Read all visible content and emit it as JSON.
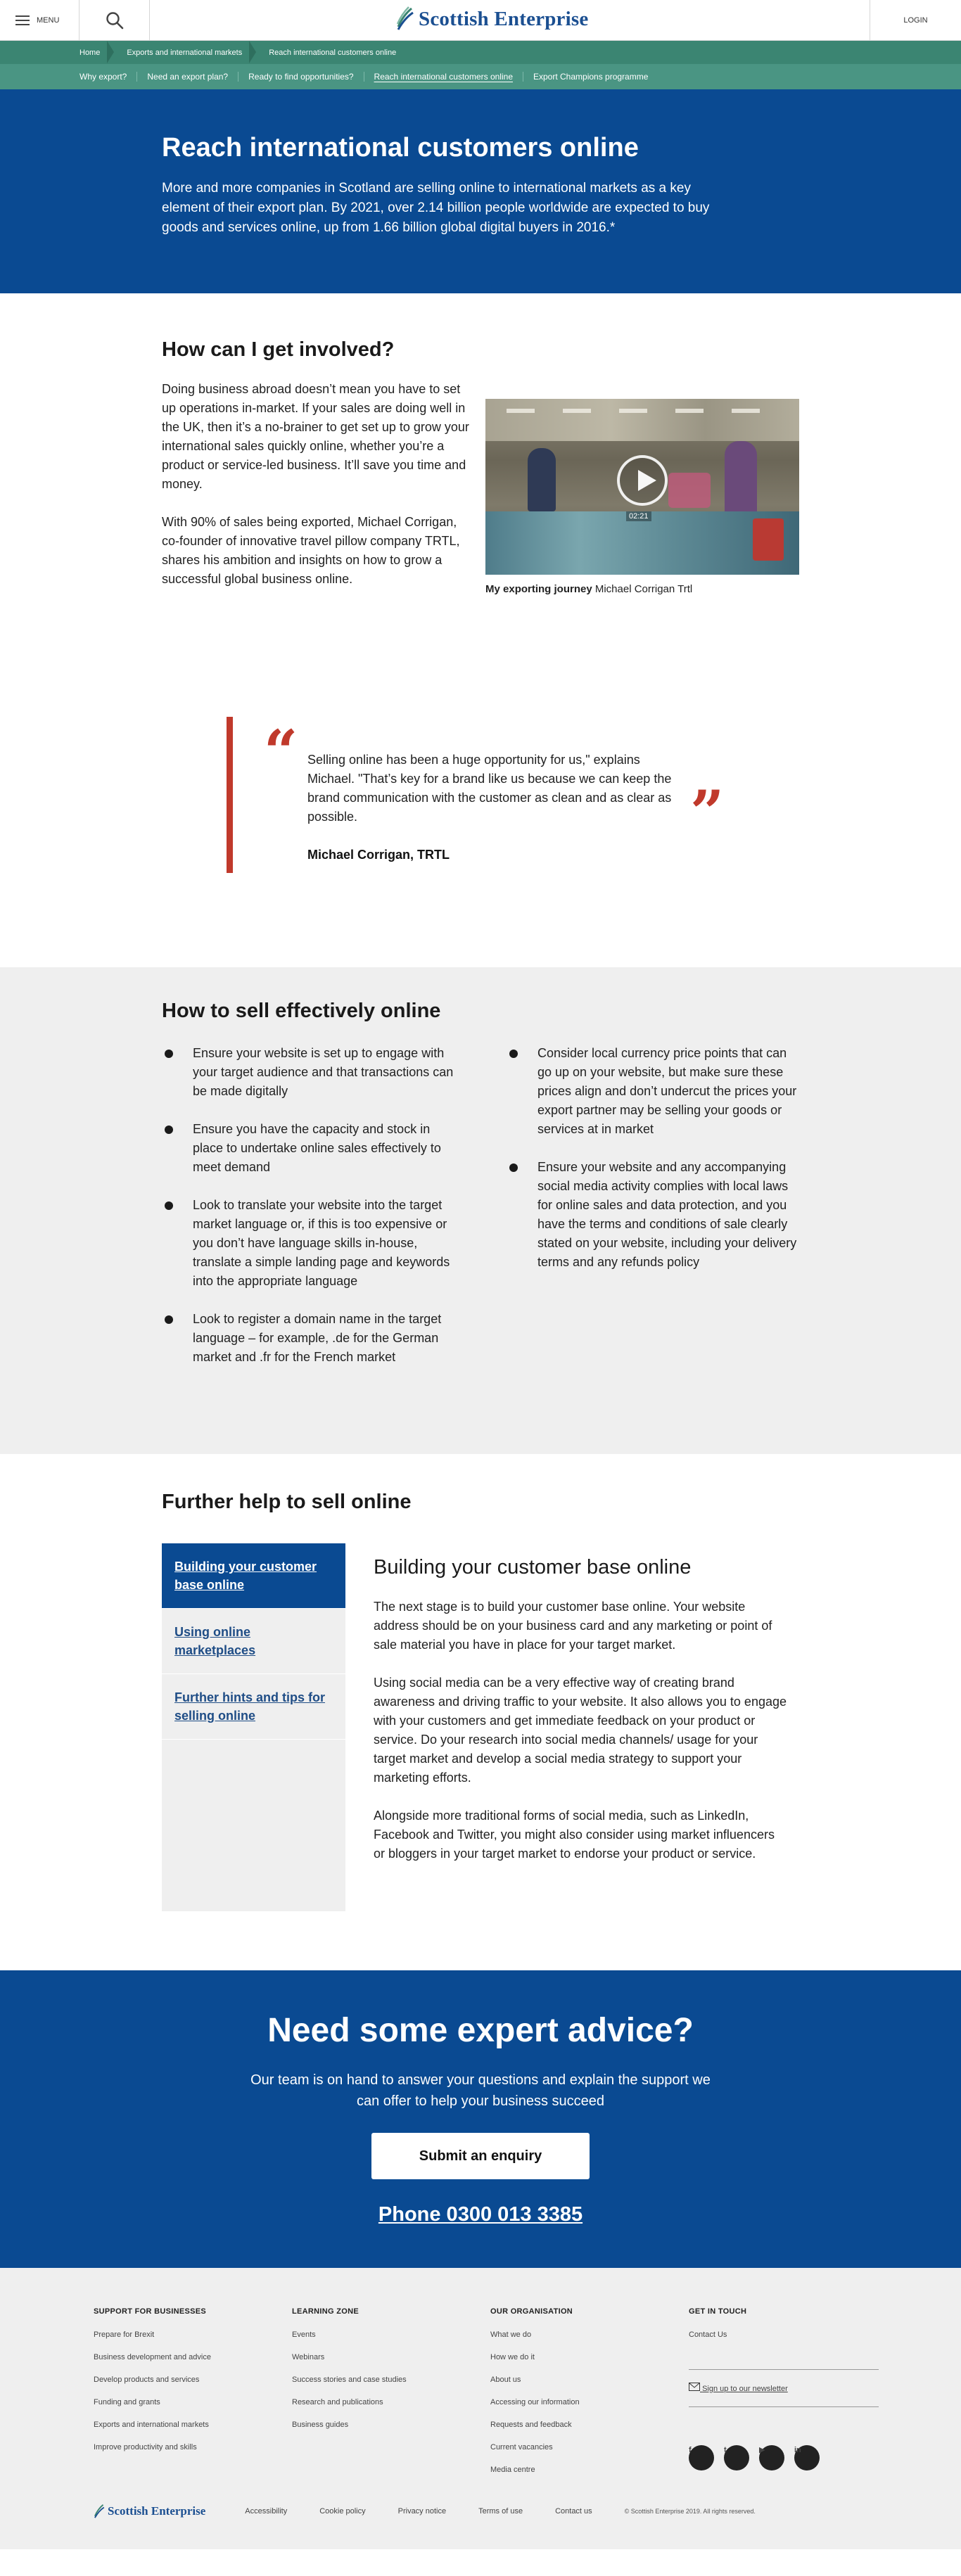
{
  "header": {
    "menu_label": "MENU",
    "logo_text": "Scottish Enterprise",
    "login_label": "LOGIN"
  },
  "breadcrumb": [
    "Home",
    "Exports and international markets",
    "Reach international customers online"
  ],
  "subnav": [
    "Why export?",
    "Need an export plan?",
    "Ready to find opportunities?",
    "Reach international customers online",
    "Export Champions programme"
  ],
  "hero": {
    "title": "Reach international customers online",
    "body": "More and more companies in Scotland are selling online to international markets as a key element of their export plan. By 2021, over 2.14 billion people worldwide are expected to buy goods and services online, up from 1.66 billion global digital buyers in 2016.*"
  },
  "involved": {
    "title": "How can I get involved?",
    "p1": "Doing business abroad doesn’t mean you have to set up operations in-market. If your sales are doing well in the UK, then it’s a no-brainer to get set up to grow your international sales quickly online, whether you’re a product or service-led business. It’ll save you time and money.",
    "p2": "With 90% of sales being exported, Michael Corrigan, co-founder of innovative travel pillow company TRTL, shares his ambition and insights on how to grow a successful global business online.",
    "video_duration": "02:21",
    "caption_bold": "My exporting journey",
    "caption_rest": "Michael Corrigan Trtl"
  },
  "quote": {
    "open_mark": "“",
    "close_mark": "”",
    "text": "Selling online has been a huge opportunity for us,\" explains Michael. \"That’s key for a brand like us because we can keep the brand communication with the customer as clean and as clear as possible.",
    "author": "Michael Corrigan, TRTL"
  },
  "sell": {
    "title": "How to sell effectively online",
    "left": [
      "Ensure your website is set up to engage with your target audience and that transactions can be made digitally",
      "Ensure you have the capacity and stock in place to undertake online sales effectively to meet demand",
      "Look to translate your website into the target market language or, if this is too expensive or you don’t have language skills in-house, translate a simple landing page and keywords into the appropriate language",
      "Look to register a domain name in the target language – for example, .de for the German market and .fr for the French market"
    ],
    "right": [
      "Consider local currency price points that can go up on your website, but make sure these prices align and don’t undercut the prices your export partner may be selling your goods or services at in market",
      "Ensure your website and any accompanying social media activity complies with local laws for online sales and data protection, and you have the terms and conditions of sale clearly stated on your website, including your delivery terms and any refunds policy"
    ]
  },
  "further": {
    "title": "Further help to sell online",
    "tabs": [
      "Building your customer base online",
      "Using online marketplaces",
      "Further hints and tips for selling online"
    ],
    "content_title": "Building your customer base online",
    "paragraphs": [
      "The next stage is to build your customer base online. Your website address should be on your business card and any marketing or point of sale material you have in place for your target market.",
      "Using social media can be a very effective way of creating brand awareness and driving traffic to your website. It also allows you to engage with your customers and get immediate feedback on your product or service. Do your research into social media channels/ usage for your target market and develop a social media strategy to support your marketing efforts.",
      "Alongside more traditional forms of social media, such as LinkedIn, Facebook and Twitter, you might also consider using market influencers or bloggers in your target market to endorse your product or service."
    ]
  },
  "expert": {
    "title": "Need some expert advice?",
    "body": "Our team is on hand to answer your questions and explain the support we can offer to help your business succeed",
    "button": "Submit an enquiry",
    "phone": "Phone 0300 013 3385"
  },
  "footer": {
    "cols": [
      {
        "heading": "SUPPORT FOR BUSINESSES",
        "links": [
          "Prepare for Brexit",
          "Business development and advice",
          "Develop products and services",
          "Funding and grants",
          "Exports and international markets",
          "Improve productivity and skills"
        ]
      },
      {
        "heading": "LEARNING ZONE",
        "links": [
          "Events",
          "Webinars",
          "Success stories and case studies",
          "Research and publications",
          "Business guides"
        ]
      },
      {
        "heading": "OUR ORGANISATION",
        "links": [
          "What we do",
          "How we do it",
          "About us",
          "Accessing our information",
          "Requests and feedback",
          "Current vacancies",
          "Media centre"
        ]
      }
    ],
    "contact_heading": "GET IN TOUCH",
    "contact_link": "Contact Us",
    "newsletter": "Sign up to our newsletter",
    "social": [
      "f",
      "t",
      "▶",
      "in"
    ],
    "logo_text": "Scottish Enterprise",
    "bottom_links": [
      "Accessibility",
      "Cookie policy",
      "Privacy notice",
      "Terms of use",
      "Contact us"
    ],
    "copyright": "© Scottish Enterprise 2019. All rights reserved."
  },
  "colors": {
    "brand_blue": "#0a4a92",
    "green_nav": "#3b8572",
    "accent_red": "#c0392b"
  }
}
